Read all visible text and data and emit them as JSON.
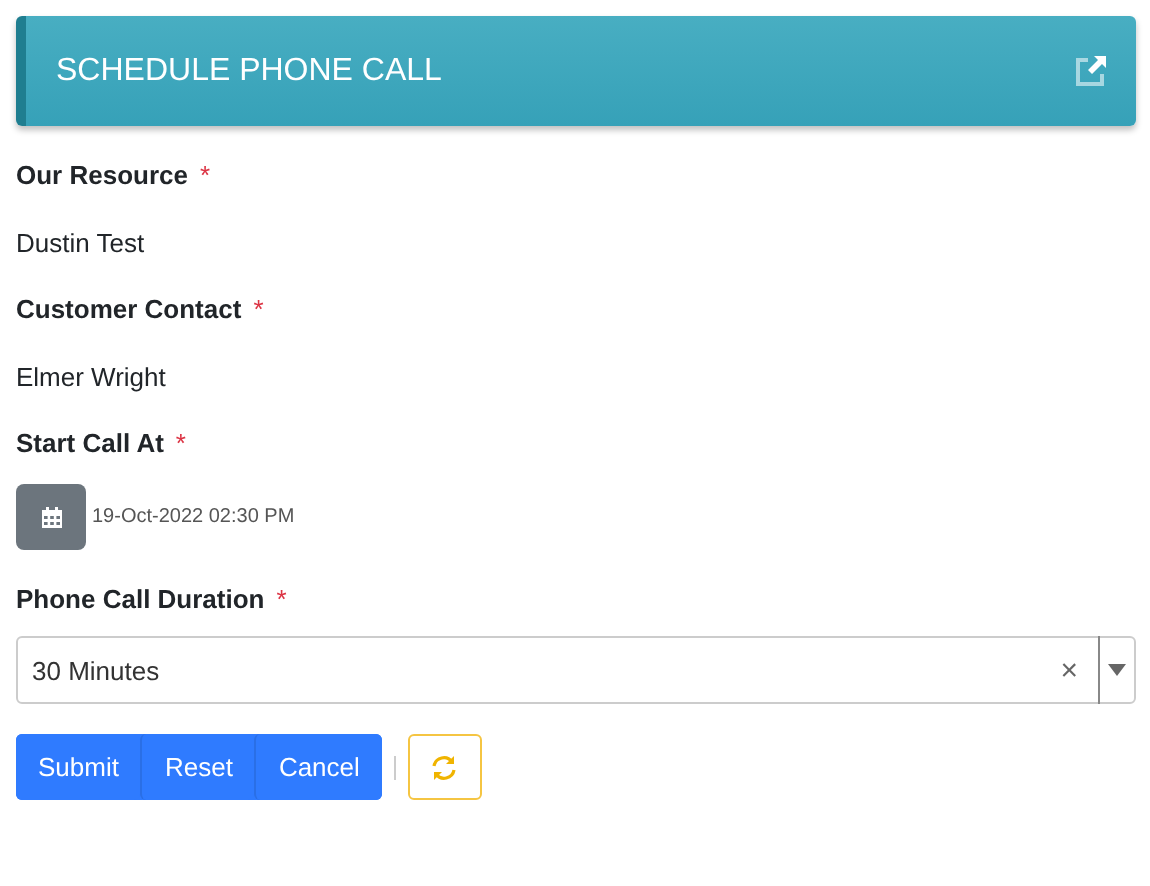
{
  "header": {
    "title": "SCHEDULE PHONE CALL"
  },
  "fields": [
    {
      "kind": "text",
      "label": "Our Resource",
      "required_mark": "*",
      "value": "Dustin Test"
    },
    {
      "kind": "text",
      "label": "Customer Contact",
      "required_mark": "*",
      "value": "Elmer Wright"
    },
    {
      "kind": "datetime",
      "label": "Start Call At",
      "required_mark": "*",
      "value": "19-Oct-2022 02:30 PM"
    },
    {
      "kind": "select",
      "label": "Phone Call Duration",
      "required_mark": "*",
      "value": "30 Minutes",
      "clear": "×"
    }
  ],
  "buttons": [
    "Submit",
    "Reset",
    "Cancel"
  ]
}
